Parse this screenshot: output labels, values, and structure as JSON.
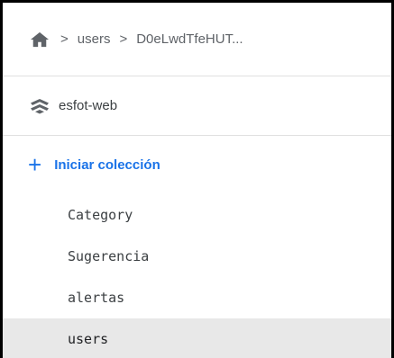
{
  "breadcrumb": {
    "items": [
      "users",
      "D0eLwdTfeHUT..."
    ],
    "separator": ">"
  },
  "project": {
    "name": "esfot-web"
  },
  "add_collection": {
    "icon": "+",
    "label": "Iniciar colección"
  },
  "collections": [
    {
      "label": "Category",
      "selected": false
    },
    {
      "label": "Sugerencia",
      "selected": false
    },
    {
      "label": "alertas",
      "selected": false
    },
    {
      "label": "users",
      "selected": true
    }
  ],
  "colors": {
    "accent": "#1a73e8",
    "text": "#3c4043",
    "selected_bg": "#e8e8e8"
  }
}
